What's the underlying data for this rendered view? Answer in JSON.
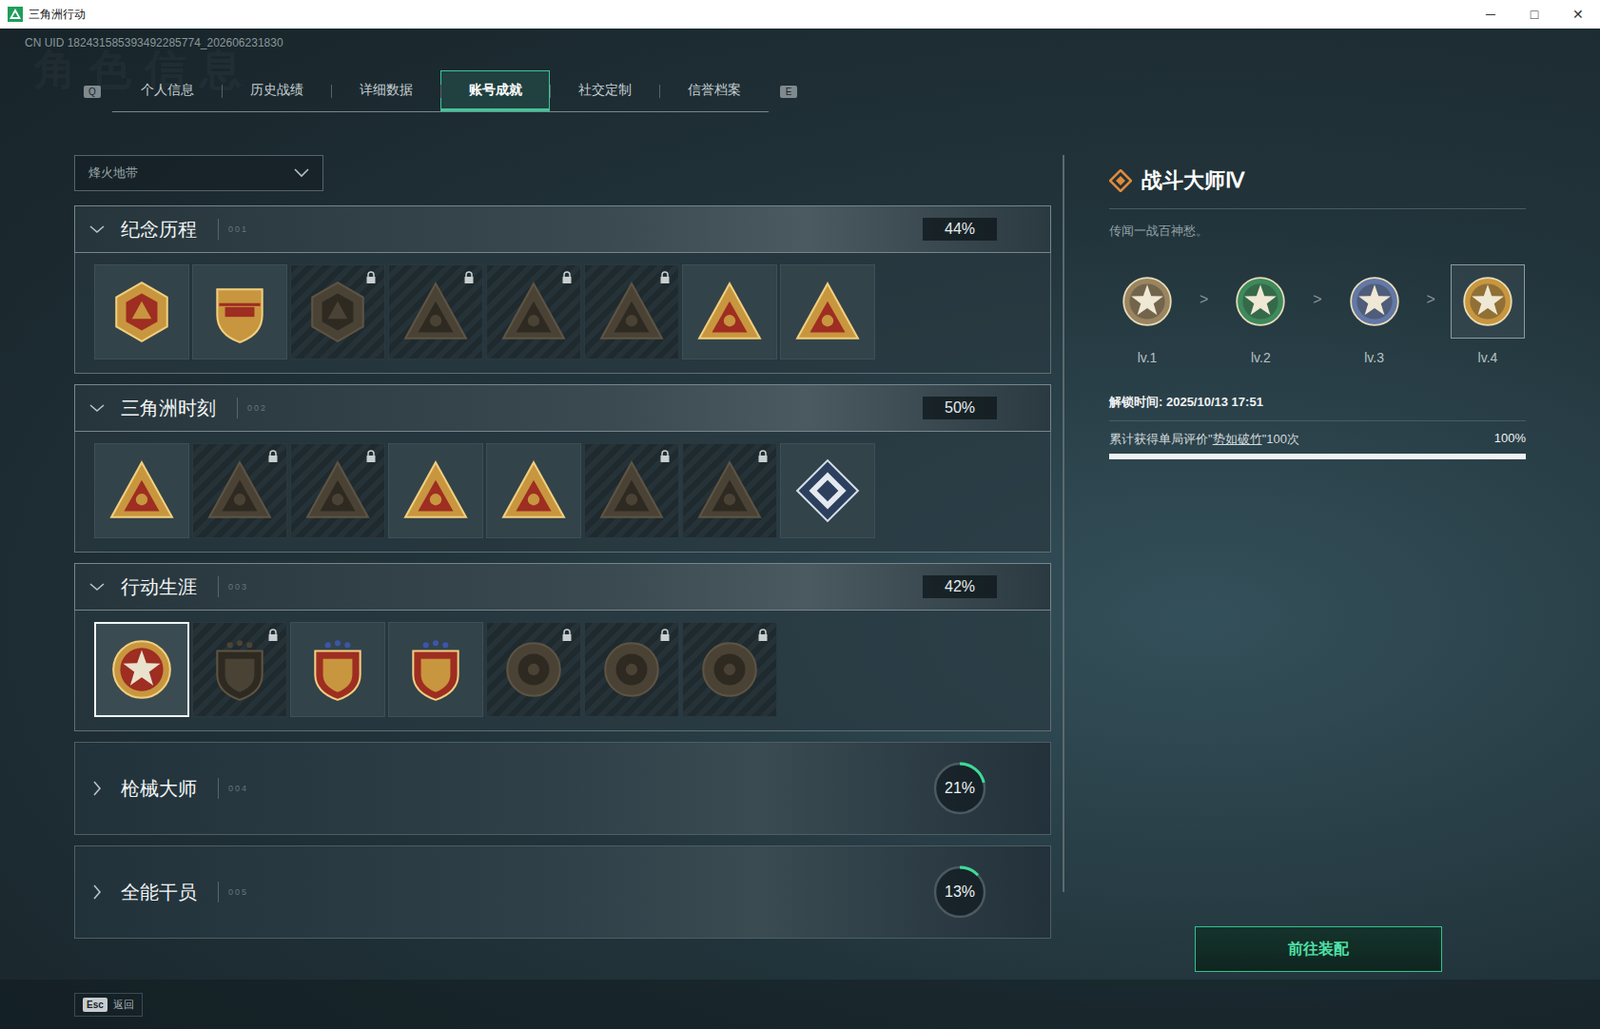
{
  "window": {
    "title": "三角洲行动",
    "controls": [
      "─",
      "□",
      "✕"
    ]
  },
  "uid": "CN UID 182431585393492285774_202606231830",
  "watermark": "角色信息",
  "tabs": {
    "prev_key": "Q",
    "next_key": "E",
    "items": [
      {
        "label": "个人信息",
        "selected": false
      },
      {
        "label": "历史战绩",
        "selected": false
      },
      {
        "label": "详细数据",
        "selected": false
      },
      {
        "label": "账号成就",
        "selected": true
      },
      {
        "label": "社交定制",
        "selected": false
      },
      {
        "label": "信誉档案",
        "selected": false
      }
    ]
  },
  "mode_select": {
    "value": "烽火地带"
  },
  "sections": [
    {
      "title": "纪念历程",
      "code": "001",
      "percent": "44%",
      "expanded": true,
      "badges": [
        {
          "kind": "hex",
          "locked": false,
          "selected": false
        },
        {
          "kind": "emblem",
          "locked": false,
          "selected": false
        },
        {
          "kind": "hex",
          "locked": true,
          "selected": false
        },
        {
          "kind": "triangle",
          "locked": true,
          "selected": false
        },
        {
          "kind": "triangle",
          "locked": true,
          "selected": false
        },
        {
          "kind": "triangle",
          "locked": true,
          "selected": false
        },
        {
          "kind": "triangle",
          "locked": false,
          "selected": false
        },
        {
          "kind": "triangle",
          "locked": false,
          "selected": false
        }
      ]
    },
    {
      "title": "三角洲时刻",
      "code": "002",
      "percent": "50%",
      "expanded": true,
      "badges": [
        {
          "kind": "triangle",
          "locked": false,
          "selected": false
        },
        {
          "kind": "triangle",
          "locked": true,
          "selected": false
        },
        {
          "kind": "triangle",
          "locked": true,
          "selected": false
        },
        {
          "kind": "triangle",
          "locked": false,
          "selected": false
        },
        {
          "kind": "triangle",
          "locked": false,
          "selected": false
        },
        {
          "kind": "triangle",
          "locked": true,
          "selected": false
        },
        {
          "kind": "triangle",
          "locked": true,
          "selected": false
        },
        {
          "kind": "diamond",
          "locked": false,
          "selected": false
        }
      ]
    },
    {
      "title": "行动生涯",
      "code": "003",
      "percent": "42%",
      "expanded": true,
      "badges": [
        {
          "kind": "star",
          "locked": false,
          "selected": true
        },
        {
          "kind": "shield",
          "locked": true,
          "selected": false
        },
        {
          "kind": "shield",
          "locked": false,
          "selected": false
        },
        {
          "kind": "shield",
          "locked": false,
          "selected": false
        },
        {
          "kind": "round",
          "locked": true,
          "selected": false
        },
        {
          "kind": "round",
          "locked": true,
          "selected": false
        },
        {
          "kind": "round",
          "locked": true,
          "selected": false
        }
      ]
    },
    {
      "title": "枪械大师",
      "code": "004",
      "percent": "21%",
      "expanded": false,
      "level": 0.21,
      "badges": []
    },
    {
      "title": "全能干员",
      "code": "005",
      "percent": "13%",
      "expanded": false,
      "level": 0.13,
      "badges": []
    }
  ],
  "detail": {
    "title": "战斗大师Ⅳ",
    "quote": "传闻一战百神愁。",
    "separator": ">",
    "levels": [
      {
        "label": "lv.1",
        "color": "#9a8560",
        "selected": false
      },
      {
        "label": "lv.2",
        "color": "#3d8a5c",
        "selected": false
      },
      {
        "label": "lv.3",
        "color": "#6378a6",
        "selected": false
      },
      {
        "label": "lv.4",
        "color": "#c8963e",
        "selected": true
      }
    ],
    "unlock": "解锁时间: 2025/10/13 17:51",
    "task": {
      "prefix": "累计获得单局评价\"",
      "keyword": "势如破竹",
      "suffix": "\"100次",
      "percent": "100%",
      "level": 1
    },
    "button": "前往装配"
  },
  "footer": {
    "key": "Esc",
    "label": "返回"
  }
}
